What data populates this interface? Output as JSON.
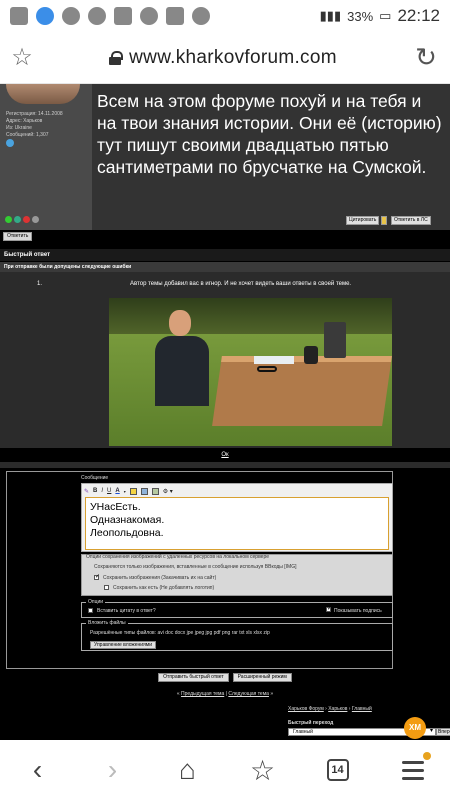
{
  "status_bar": {
    "battery": "33%",
    "time": "22:12"
  },
  "browser": {
    "url": "www.kharkovforum.com",
    "tabs_count": "14"
  },
  "post": {
    "profile_lines": [
      "Регистрация: 14.11.2008",
      "Адрес: Харьков",
      "Из: Ukraine",
      "Сообщений: 1,307"
    ],
    "text": "Всем на этом форуме похуй и на тебя и на твои знания истории. Они её (историю) тут пишут своими двадцатью пятью сантиметрами по брусчатке на Сумской.",
    "cite_button": "Цитировать",
    "quick_reply_button": "Ответить в ЛС",
    "answer_button": "Ответить"
  },
  "quick_reply": {
    "header": "Быстрый ответ",
    "errors_header": "При отправке были допущены следующие ошибки",
    "error_number": "1.",
    "error_message": "Автор темы добавил вас в игнор. И не хочет видеть ваши ответы в своей теме.",
    "ok_link": "Ок"
  },
  "editor": {
    "message_label": "Сообщение",
    "message_lines": [
      "УНасЕсть.",
      "Одназнакомая.",
      "Леопольдовна."
    ]
  },
  "image_options": {
    "legend": "Опции сохранения изображений с удаленных ресурсов на локальном сервере",
    "note": "Сохраняются только изображения, вставленные в сообщение используя BBкоды [IMG]",
    "save_images": "Сохранить изображения (Закачивать их на сайт)",
    "save_as_is": "Сохранить как есть (Не добавлять логотип)"
  },
  "options": {
    "legend": "Опции",
    "quote_in_reply": "Вставить цитату в ответ?",
    "show_signature": "Показывать подпись"
  },
  "attachments": {
    "legend": "Вложить файлы",
    "allowed_types": "Разрешённые типы файлов: avi doc docx jpe jpeg jpg pdf png rar txt xls xlsx zip",
    "manage_button": "Управление вложениями"
  },
  "actions": {
    "submit_quick": "Отправить быстрый ответ",
    "advanced_mode": "Расширенный режим"
  },
  "footer": {
    "nav_prefix": "«",
    "prev_thread": "Предыдущая тема",
    "nav_sep": "|",
    "next_thread": "Следующая тема",
    "nav_suffix": "»",
    "crumb_1": "Харьков Форум",
    "crumb_2": "Харьков",
    "crumb_3": "Главный",
    "crumb_sep": "›",
    "quick_nav_label": "Быстрый переход",
    "quick_nav_value": "Главный",
    "go_button": "Вперёд"
  },
  "floating_badge": "XM"
}
